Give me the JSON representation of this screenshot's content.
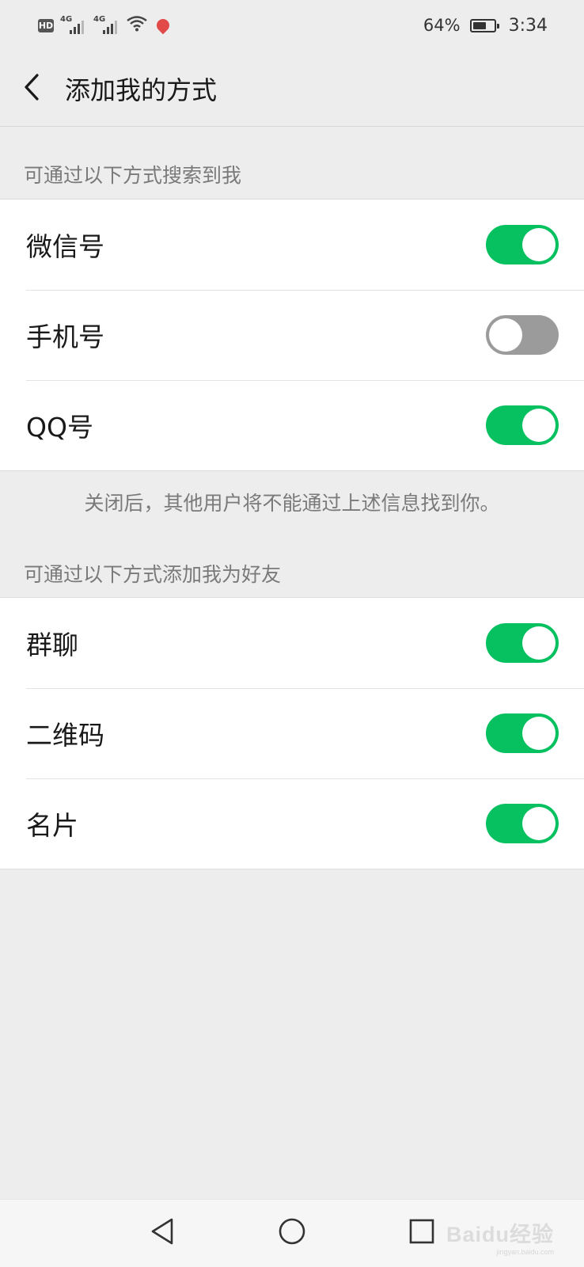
{
  "status_bar": {
    "hd": "HD",
    "network1": "4G",
    "network2": "4G",
    "battery_percent": "64%",
    "battery_level": 0.64,
    "time": "3:34",
    "icons": [
      "hd-icon",
      "signal-icon",
      "signal-icon",
      "wifi-icon",
      "location-pin-icon",
      "battery-icon"
    ]
  },
  "nav": {
    "back_icon": "chevron-left-icon",
    "title": "添加我的方式"
  },
  "search_section": {
    "header": "可通过以下方式搜索到我",
    "items": [
      {
        "label": "微信号",
        "enabled": true
      },
      {
        "label": "手机号",
        "enabled": false
      },
      {
        "label": "QQ号",
        "enabled": true
      }
    ],
    "hint": "关闭后，其他用户将不能通过上述信息找到你。"
  },
  "add_section": {
    "header": "可通过以下方式添加我为好友",
    "items": [
      {
        "label": "群聊",
        "enabled": true
      },
      {
        "label": "二维码",
        "enabled": true
      },
      {
        "label": "名片",
        "enabled": true
      }
    ]
  },
  "colors": {
    "switch_on": "#07c160",
    "switch_off": "#9b9b9b",
    "background": "#ededed"
  },
  "system_nav": {
    "icons": [
      "triangle-back-icon",
      "circle-home-icon",
      "square-recents-icon"
    ]
  },
  "watermark": {
    "main": "Baidu经验",
    "sub": "jingyan.baidu.com"
  }
}
